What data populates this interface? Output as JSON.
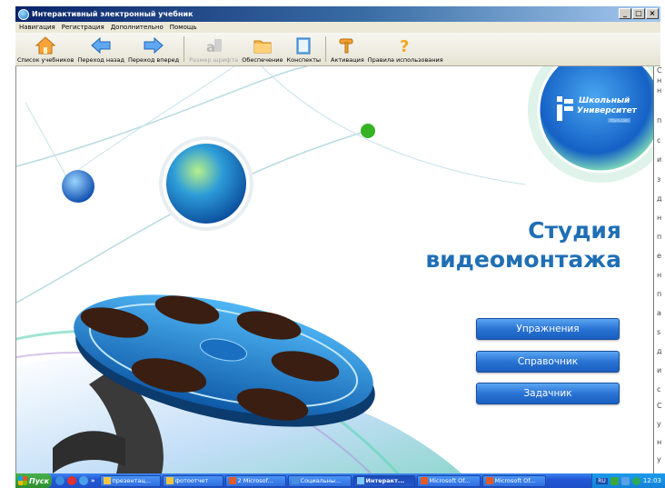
{
  "window": {
    "title": "Интерактивный электронный учебник",
    "buttons": [
      "_",
      "□",
      "×"
    ]
  },
  "menu": [
    "Навигация",
    "Регистрация",
    "Дополнительно",
    "Помощь"
  ],
  "toolbar": [
    {
      "label": "Список учебников",
      "icon": "home-icon",
      "enabled": true
    },
    {
      "label": "Переход назад",
      "icon": "arrow-left-icon",
      "enabled": true
    },
    {
      "label": "Переход вперед",
      "icon": "arrow-right-icon",
      "enabled": true
    },
    {
      "label": "Размер шрифта",
      "icon": "font-size-icon",
      "enabled": false
    },
    {
      "label": "Обеспечение",
      "icon": "folder-icon",
      "enabled": true
    },
    {
      "label": "Конспекты",
      "icon": "notebook-icon",
      "enabled": true
    },
    {
      "label": "Активация",
      "icon": "key-icon",
      "enabled": true
    },
    {
      "label": "Правила использования",
      "icon": "help-icon",
      "enabled": true
    }
  ],
  "content": {
    "logo": {
      "line1": "Школьный",
      "line2": "Университет",
      "tag": "ttfpm.com"
    },
    "title_line1": "Студия",
    "title_line2": "видеомонтажа",
    "buttons": [
      "Упражнения",
      "Справочник",
      "Задачник"
    ],
    "accent_color": "#1f6fb5"
  },
  "right_strip_letters": [
    "С",
    "н",
    "н",
    "п",
    "с",
    "и",
    "з",
    "д",
    "н",
    "п",
    "е",
    "н",
    "п",
    "а",
    "s",
    "д",
    "и",
    "с",
    "С",
    "у",
    "н",
    "у"
  ],
  "taskbar": {
    "start": "Пуск",
    "more": "»",
    "tasks": [
      {
        "label": "презентац...",
        "icon": "folder-icon",
        "active": false
      },
      {
        "label": "фотоотчет",
        "icon": "folder-icon",
        "active": false
      },
      {
        "label": "2 Microsof...",
        "icon": "powerpoint-icon",
        "active": false
      },
      {
        "label": "Социальны...",
        "icon": "browser-icon",
        "active": false
      },
      {
        "label": "Интеракт...",
        "icon": "app-icon",
        "active": true
      },
      {
        "label": "Microsoft Of...",
        "icon": "powerpoint-icon",
        "active": false
      },
      {
        "label": "Microsoft Of...",
        "icon": "powerpoint-icon",
        "active": false
      }
    ],
    "tray_lang": "RU",
    "time": "12:03"
  }
}
